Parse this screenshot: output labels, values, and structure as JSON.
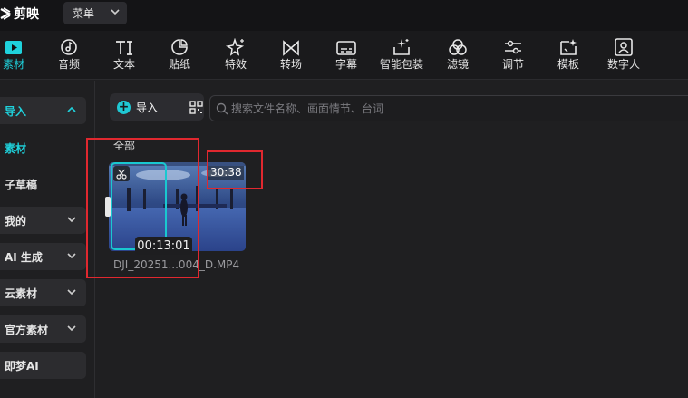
{
  "app": {
    "name": "剪映"
  },
  "menu": {
    "label": "菜单"
  },
  "toolbar": {
    "items": [
      {
        "label": "素材",
        "icon": "media-play-icon",
        "active": true
      },
      {
        "label": "音频",
        "icon": "music-note-icon"
      },
      {
        "label": "文本",
        "icon": "text-ti-icon"
      },
      {
        "label": "贴纸",
        "icon": "sticker-icon"
      },
      {
        "label": "特效",
        "icon": "sparkle-star-icon"
      },
      {
        "label": "转场",
        "icon": "transition-bowtie-icon"
      },
      {
        "label": "字幕",
        "icon": "caption-icon"
      },
      {
        "label": "智能包装",
        "icon": "smart-package-icon"
      },
      {
        "label": "滤镜",
        "icon": "filter-circles-icon"
      },
      {
        "label": "调节",
        "icon": "adjust-sliders-icon"
      },
      {
        "label": "模板",
        "icon": "template-icon"
      },
      {
        "label": "数字人",
        "icon": "digital-human-icon"
      }
    ]
  },
  "sidebar": {
    "items": [
      {
        "label": "导入",
        "expanded": true
      },
      {
        "label": "素材"
      },
      {
        "label": "子草稿"
      },
      {
        "label": "我的"
      },
      {
        "label": "AI 生成"
      },
      {
        "label": "云素材"
      },
      {
        "label": "官方素材"
      },
      {
        "label": "即梦AI"
      }
    ]
  },
  "main": {
    "import_label": "导入",
    "search_placeholder": "搜索文件名称、画面情节、台词",
    "section_label": "全部",
    "clip": {
      "duration": "30:38",
      "cursor_time": "00:13:01",
      "filename": "DJI_20251...004_D.MP4"
    }
  },
  "colors": {
    "accent": "#1fd2dc",
    "annotation": "#e0282f",
    "background": "#1f1f21"
  }
}
